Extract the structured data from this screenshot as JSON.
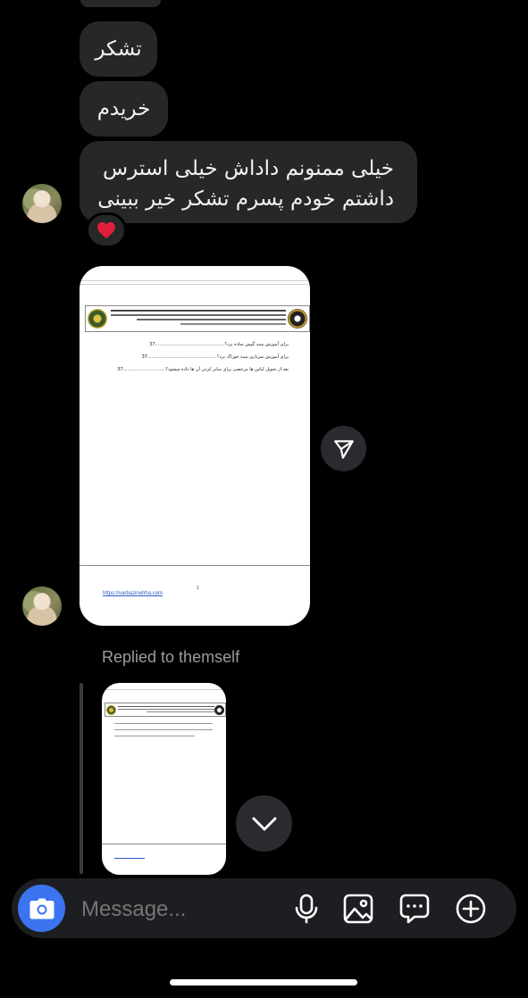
{
  "messages": [
    {
      "text": "تشکر"
    },
    {
      "text": "خریدم"
    },
    {
      "line1": "خیلی ممنونم داداش خیلی استرس",
      "line2": "داشتم خودم پسرم تشکر خیر ببینی",
      "reaction": "❤️"
    }
  ],
  "shared_document": {
    "link_text": "https://varbazinehha.com",
    "questions": [
      {
        "num": "37",
        "text": "برای آموزش میته گوش ساده برد؟"
      },
      {
        "num": "37",
        "text": "برای آموزش سرباری میته خوراک برد؟"
      },
      {
        "num": "37",
        "text": "بعد از تحویل لباس ها مرخصی برای سایر کردن آن ها داده میشود؟"
      }
    ],
    "page_number": "1"
  },
  "reply_label": "Replied to themself",
  "composer": {
    "placeholder": "Message..."
  },
  "colors": {
    "background": "#000000",
    "bubble": "#262729",
    "camera_button": "#3b74f1",
    "composer": "#1d1e21"
  }
}
